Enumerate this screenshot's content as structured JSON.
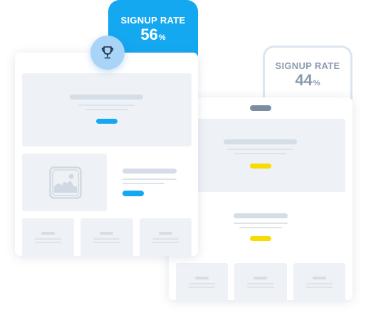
{
  "variant_a": {
    "metric_label": "SIGNUP RATE",
    "metric_value": "56",
    "metric_unit": "%",
    "winner_icon": "trophy-icon",
    "accent_color": "#14a8f0"
  },
  "variant_b": {
    "metric_label": "SIGNUP RATE",
    "metric_value": "44",
    "metric_unit": "%",
    "accent_color": "#f6dc00"
  }
}
